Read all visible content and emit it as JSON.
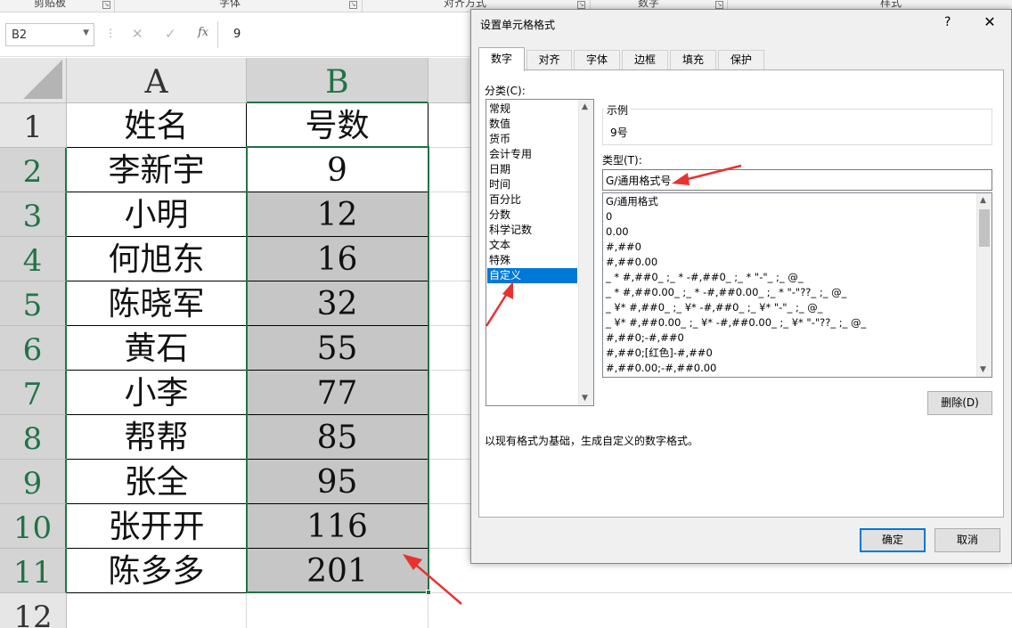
{
  "ribbon": {
    "groups": [
      "剪贴板",
      "字体",
      "对齐方式",
      "数字",
      "样式"
    ]
  },
  "formula_bar": {
    "name_box": "B2",
    "cancel_icon": "✕",
    "enter_icon": "✓",
    "fx_label": "fx",
    "value": "9"
  },
  "sheet": {
    "columns": [
      "A",
      "B"
    ],
    "row_numbers": [
      "1",
      "2",
      "3",
      "4",
      "5",
      "6",
      "7",
      "8",
      "9",
      "10",
      "11",
      "12"
    ],
    "header": {
      "name": "姓名",
      "number": "号数"
    },
    "rows": [
      {
        "name": "李新宇",
        "number": "9"
      },
      {
        "name": "小明",
        "number": "12"
      },
      {
        "name": "何旭东",
        "number": "16"
      },
      {
        "name": "陈晓军",
        "number": "32"
      },
      {
        "name": "黄石",
        "number": "55"
      },
      {
        "name": "小李",
        "number": "77"
      },
      {
        "name": "帮帮",
        "number": "85"
      },
      {
        "name": "张全",
        "number": "95"
      },
      {
        "name": "张开开",
        "number": "116"
      },
      {
        "name": "陈多多",
        "number": "201"
      }
    ]
  },
  "dialog": {
    "title": "设置单元格格式",
    "help": "?",
    "close": "✕",
    "tabs": [
      "数字",
      "对齐",
      "字体",
      "边框",
      "填充",
      "保护"
    ],
    "category_label": "分类(C):",
    "categories": [
      "常规",
      "数值",
      "货币",
      "会计专用",
      "日期",
      "时间",
      "百分比",
      "分数",
      "科学记数",
      "文本",
      "特殊",
      "自定义"
    ],
    "selected_category": "自定义",
    "sample_label": "示例",
    "sample_value": "9号",
    "type_label": "类型(T):",
    "type_value": "G/通用格式号",
    "formats": [
      "G/通用格式",
      "0",
      "0.00",
      "#,##0",
      "#,##0.00",
      "_ * #,##0_ ;_ * -#,##0_ ;_ * \"-\"_ ;_ @_",
      "_ * #,##0.00_ ;_ * -#,##0.00_ ;_ * \"-\"??_ ;_ @_",
      "_ ¥* #,##0_ ;_ ¥* -#,##0_ ;_ ¥* \"-\"_ ;_ @_",
      "_ ¥* #,##0.00_ ;_ ¥* -#,##0.00_ ;_ ¥* \"-\"??_ ;_ @_",
      "#,##0;-#,##0",
      "#,##0;[红色]-#,##0",
      "#,##0.00;-#,##0.00"
    ],
    "delete_button": "删除(D)",
    "description": "以现有格式为基础，生成自定义的数字格式。",
    "ok_button": "确定",
    "cancel_button": "取消"
  },
  "colors": {
    "excel_green": "#217346",
    "selection_blue": "#0078d7",
    "arrow_red": "#e8322f",
    "selected_fill": "#c6c6c6"
  }
}
